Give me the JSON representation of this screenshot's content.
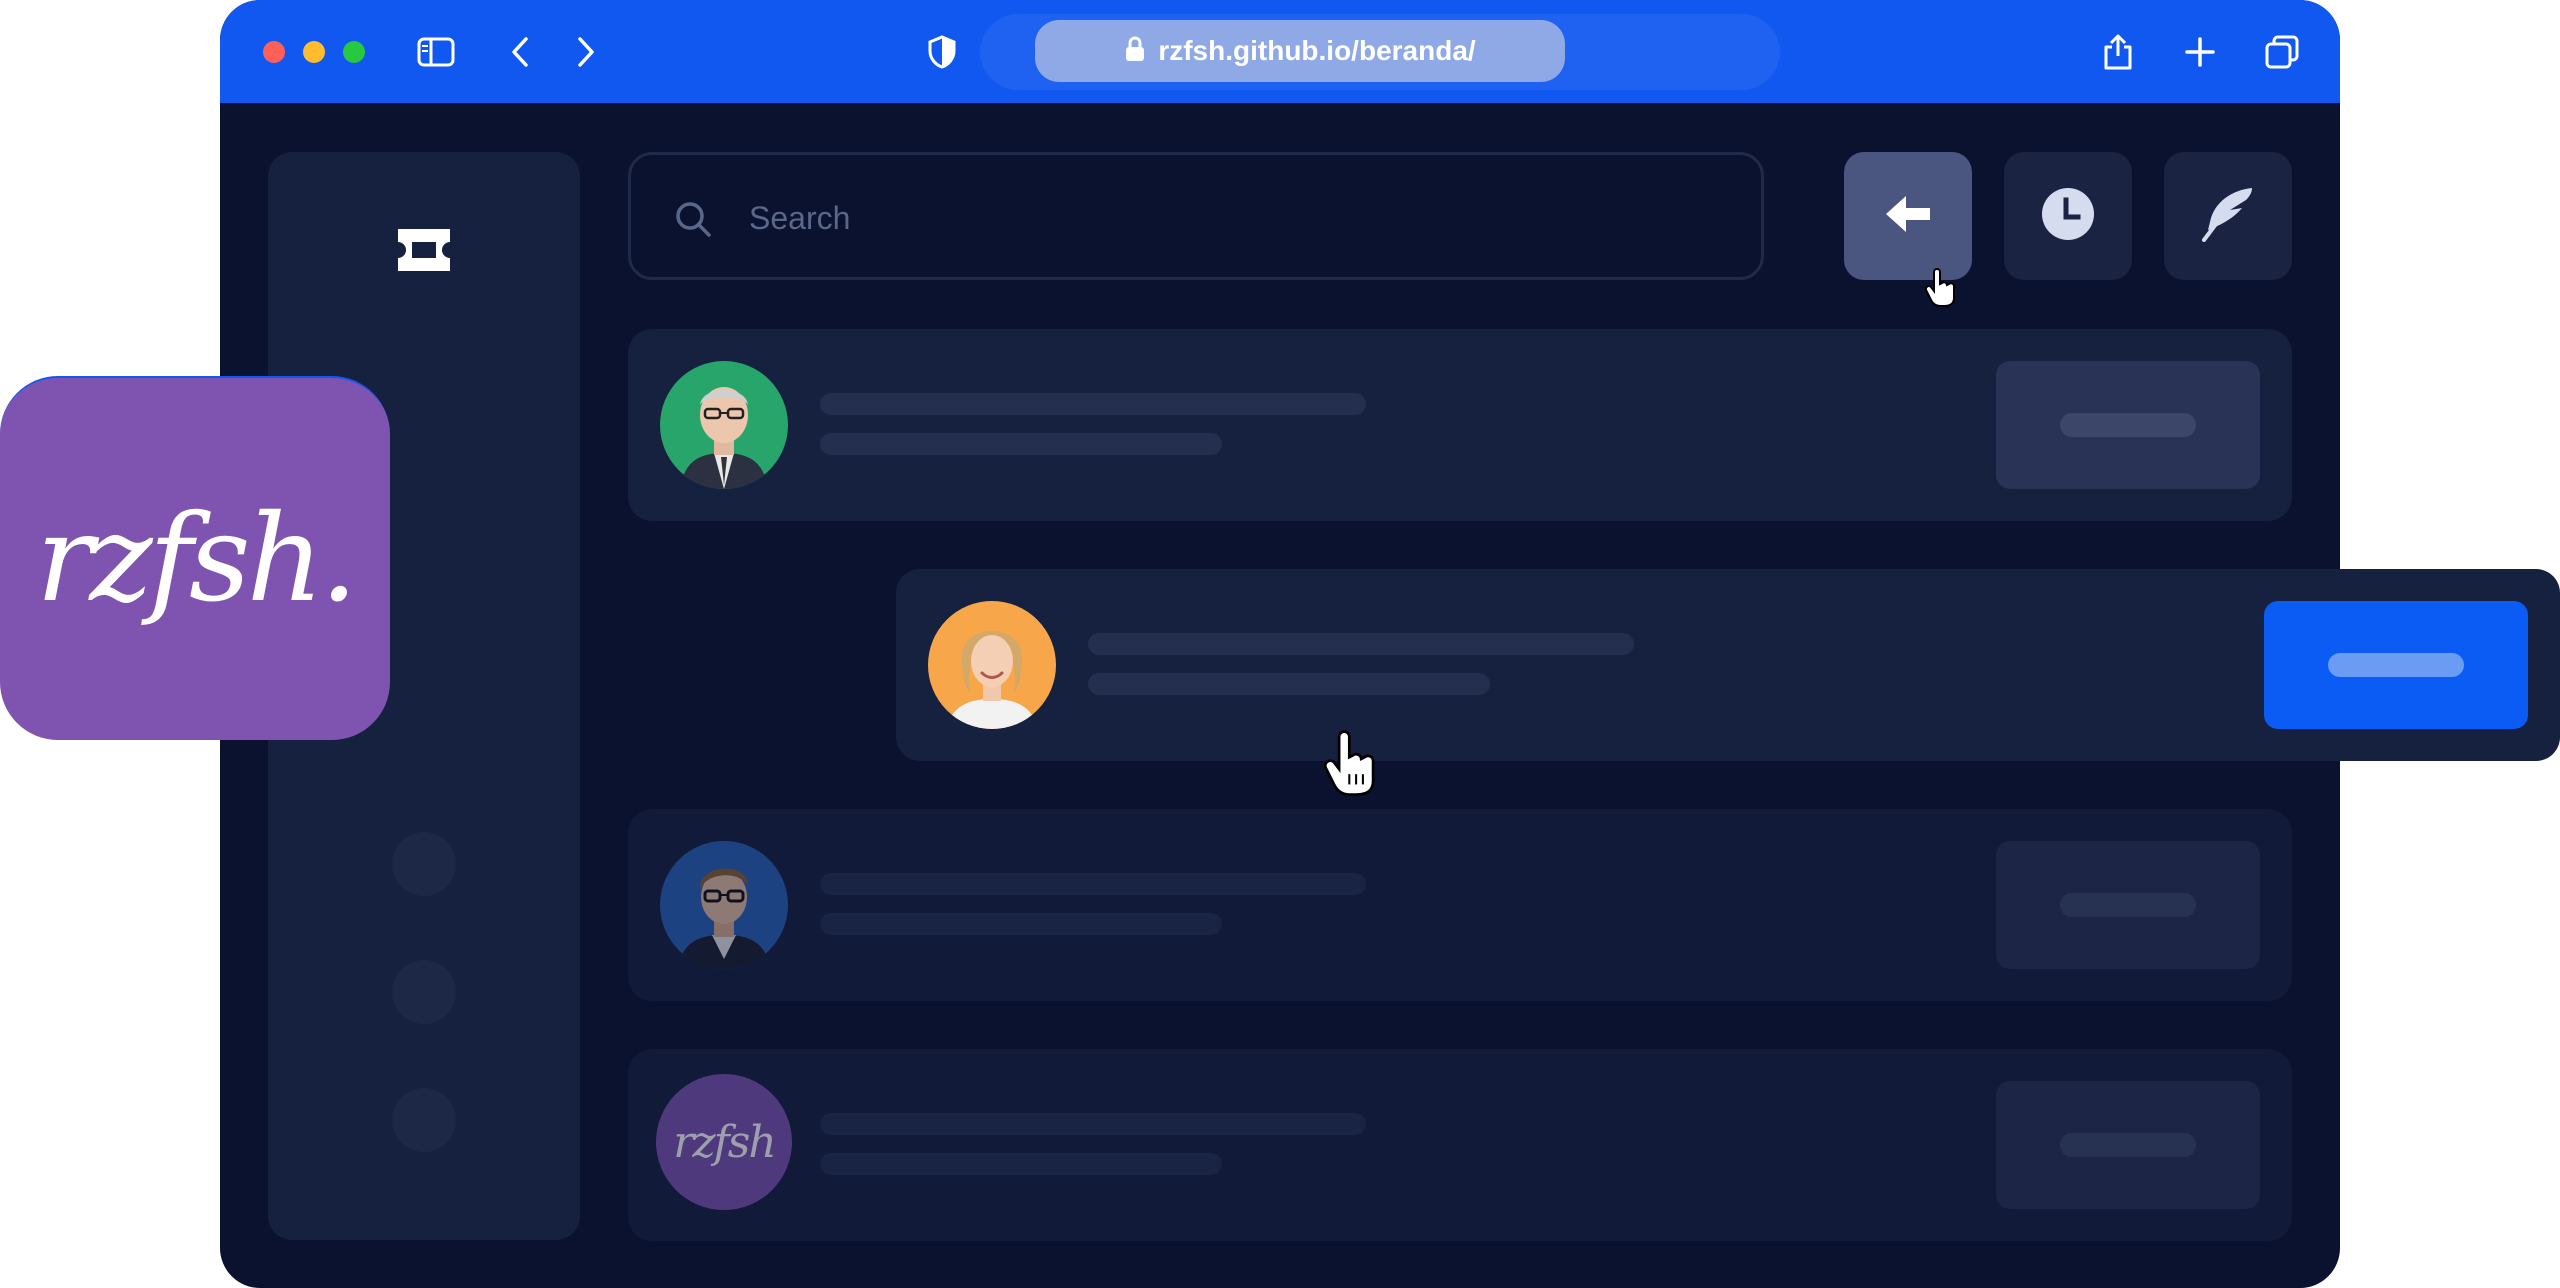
{
  "browser": {
    "url": "rzfsh.github.io/beranda/",
    "accent_color": "#1158f0",
    "icons": [
      "sidebar-toggle-icon",
      "back-chevron-icon",
      "forward-chevron-icon",
      "shield-icon",
      "lock-icon",
      "share-icon",
      "plus-icon",
      "tabs-icon"
    ]
  },
  "app": {
    "search": {
      "placeholder": "Search"
    },
    "actions": [
      "back-arrow-icon",
      "clock-icon",
      "feather-icon"
    ],
    "sidebar": {
      "logo_icon": "ticket-icon",
      "nav_dots": 3
    },
    "rows": [
      {
        "avatar": "man-with-glasses-green-bg",
        "button_state": "default"
      },
      {
        "avatar": "woman-blonde-orange-bg",
        "button_state": "active"
      },
      {
        "avatar": "man-with-glasses-blue-bg",
        "button_state": "default"
      },
      {
        "avatar": "rzfsh-logo",
        "avatar_text": "rzfsh",
        "button_state": "default"
      }
    ]
  },
  "brand": {
    "logo_text": "rzfsh.",
    "color": "#7e54b0"
  }
}
